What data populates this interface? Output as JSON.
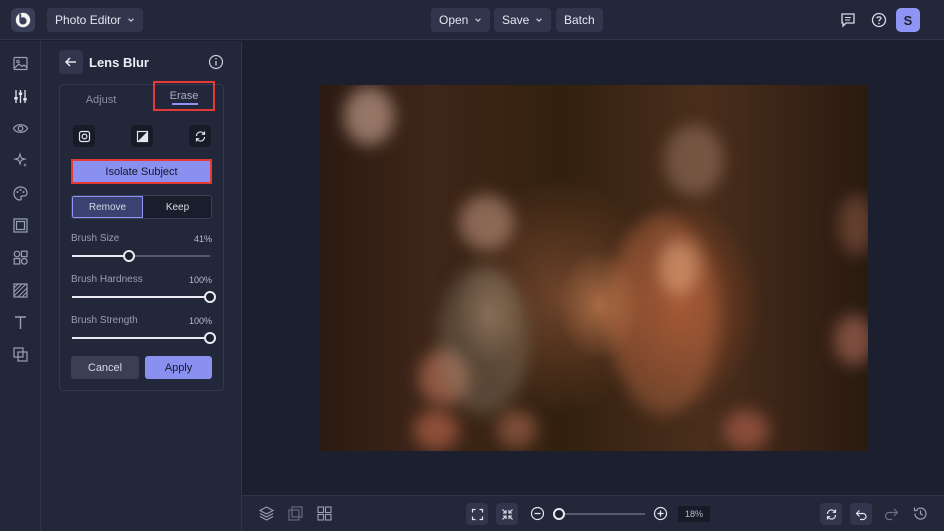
{
  "topbar": {
    "app_menu_label": "Photo Editor",
    "open_label": "Open",
    "save_label": "Save",
    "batch_label": "Batch",
    "user_initial": "S",
    "icons": [
      "logo-icon",
      "comment-icon",
      "help-icon"
    ]
  },
  "rail": {
    "icons": [
      "image-icon",
      "adjustments-icon",
      "eye-icon",
      "magic-icon",
      "palette-icon",
      "frame-icon",
      "shapes-icon",
      "texture-icon",
      "text-icon",
      "overlay-icon"
    ]
  },
  "panel": {
    "title": "Lens Blur",
    "tabs": [
      {
        "label": "Adjust",
        "active": false
      },
      {
        "label": "Erase",
        "active": true
      }
    ],
    "isolate_label": "Isolate Subject",
    "mode": {
      "remove_label": "Remove",
      "keep_label": "Keep",
      "selected": "Remove"
    },
    "sliders": [
      {
        "label": "Brush Size",
        "value_text": "41%",
        "value": 0.41
      },
      {
        "label": "Brush Hardness",
        "value_text": "100%",
        "value": 1.0
      },
      {
        "label": "Brush Strength",
        "value_text": "100%",
        "value": 1.0
      }
    ],
    "cancel_label": "Cancel",
    "apply_label": "Apply"
  },
  "bottombar": {
    "zoom_text": "18%",
    "zoom_value": 0.18
  },
  "colors": {
    "accent": "#8a90f0",
    "highlight_border": "#e53935",
    "bg": "#1c1f2e",
    "panel": "#23273a"
  }
}
